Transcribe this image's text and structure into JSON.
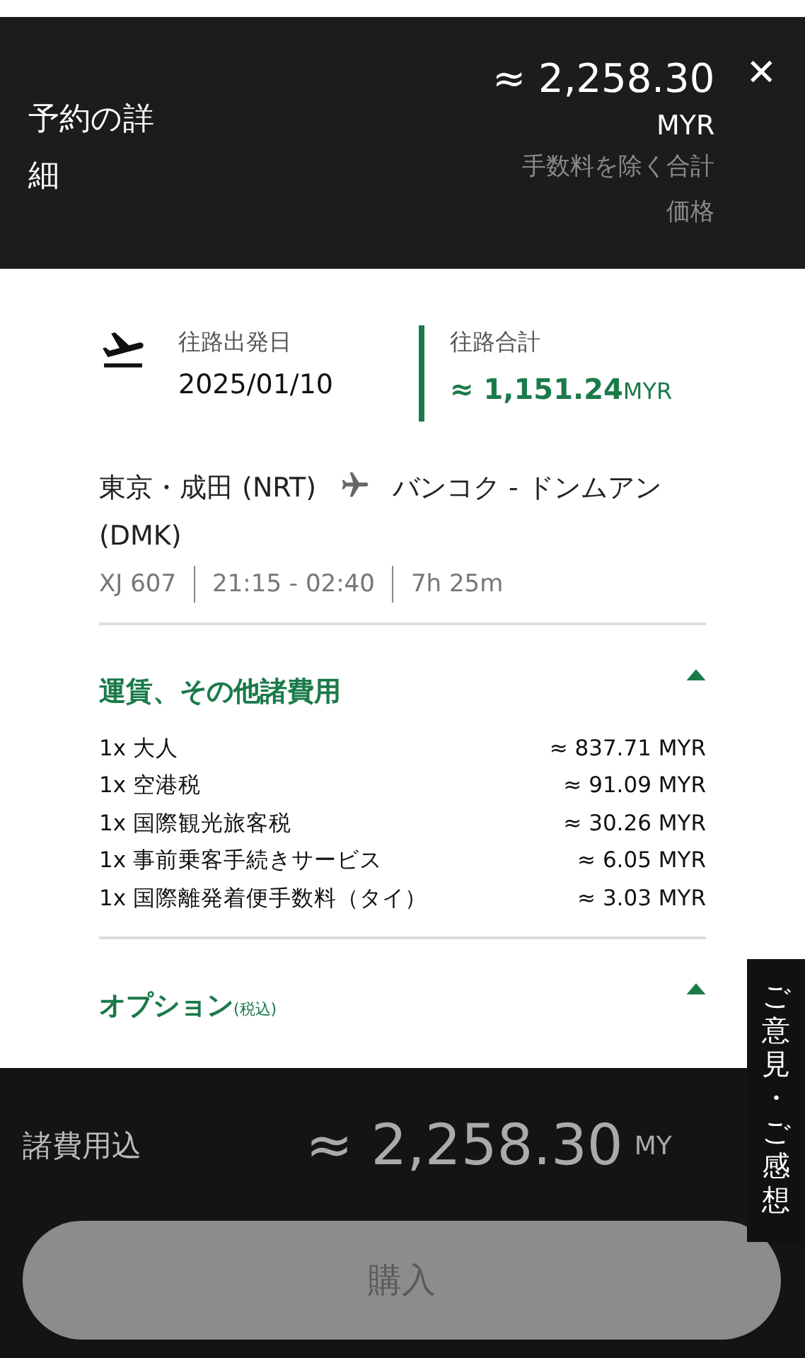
{
  "header": {
    "title": "予約の詳細",
    "total": "≈ 2,258.30",
    "currency": "MYR",
    "note": "手数料を除く合計価格",
    "close": "✕"
  },
  "outbound": {
    "date_label": "往路出発日",
    "date": "2025/01/10",
    "total_label": "往路合計",
    "total": "≈ 1,151.24",
    "currency": "MYR"
  },
  "route": {
    "from": "東京・成田 (NRT)",
    "to": "バンコク - ドンムアン (DMK)",
    "flight": "XJ 607",
    "time": "21:15 - 02:40",
    "duration": "7h 25m"
  },
  "sections": [
    {
      "title": "運賃、その他諸費用",
      "expanded": true,
      "items": [
        {
          "label": "1x 大人",
          "amount": "≈ 837.71 MYR"
        },
        {
          "label": "1x 空港税",
          "amount": "≈ 91.09 MYR"
        },
        {
          "label": "1x 国際観光旅客税",
          "amount": "≈ 30.26 MYR"
        },
        {
          "label": "1x 事前乗客手続きサービス",
          "amount": "≈ 6.05 MYR"
        },
        {
          "label": "1x 国際離発着便手数料（タイ）",
          "amount": "≈ 3.03 MYR"
        }
      ]
    },
    {
      "title": "オプション",
      "note": "(税込)",
      "expanded": true
    }
  ],
  "footer": {
    "label": "諸費用込",
    "total": "≈ 2,258.30",
    "currency": "MY",
    "button": "購入",
    "disabled": true
  },
  "feedback_tab": "ご意見・ご感想"
}
